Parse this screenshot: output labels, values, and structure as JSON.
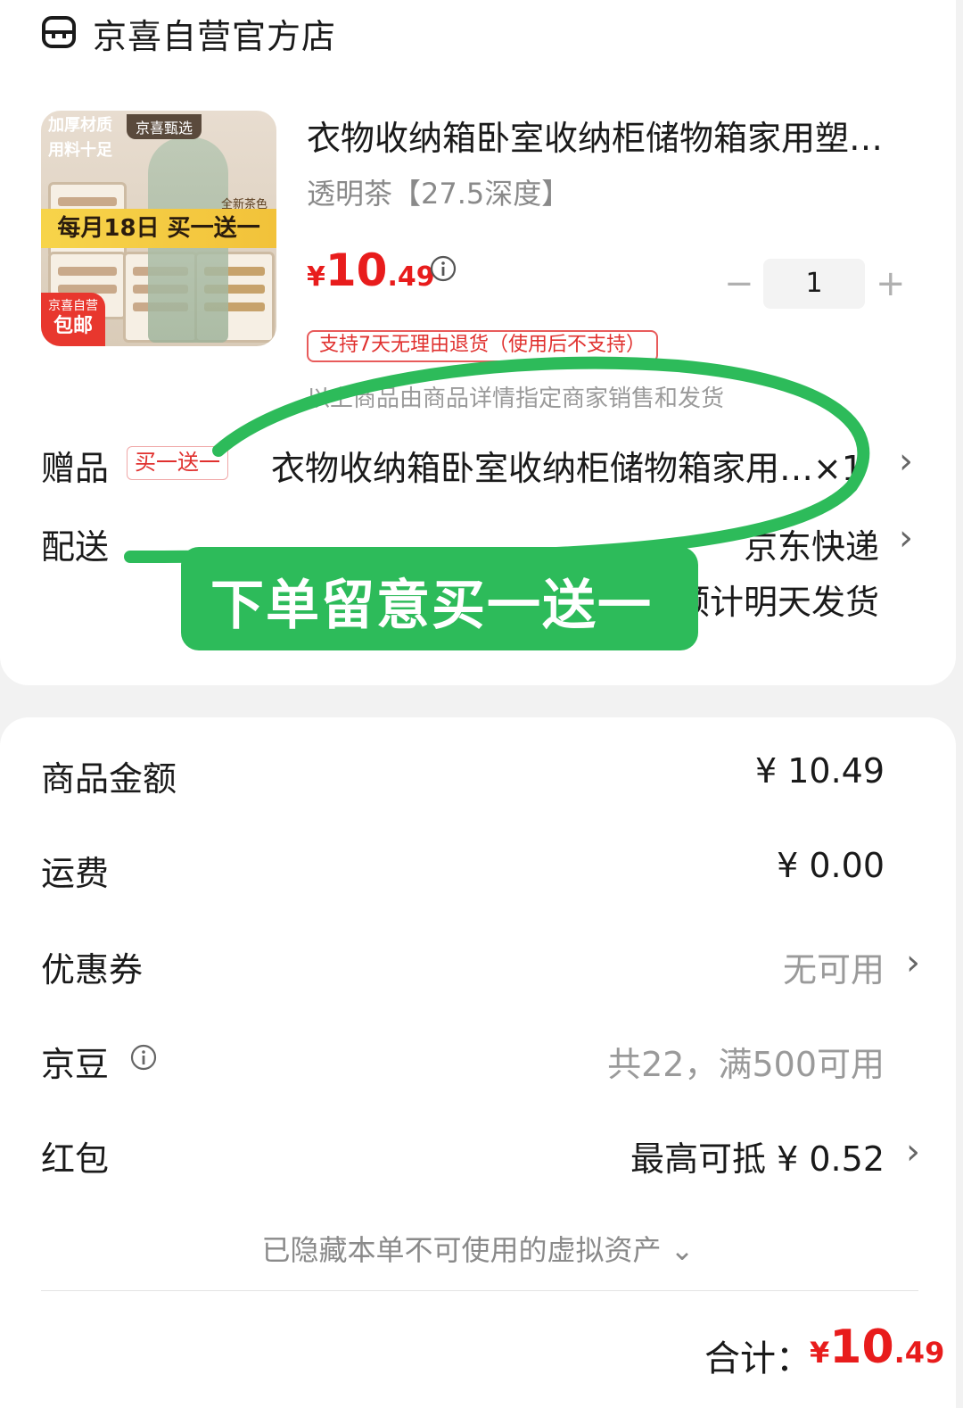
{
  "store": {
    "name": "京喜自营官方店",
    "icon": "store-icon"
  },
  "product": {
    "image": {
      "tag_line1": "加厚材质",
      "tag_line2": "用料十足",
      "brand_tag": "京喜甄选",
      "banner": "每月18日 买一送一",
      "color_tag": "全新茶色",
      "free_line1": "京喜自营",
      "free_line2": "包邮"
    },
    "title": "衣物收纳箱卧室收纳柜储物箱家用塑…",
    "spec": "透明茶【27.5深度】",
    "price": {
      "currency": "¥",
      "integer": "10",
      "decimal": ".49",
      "color": "#e81c1c"
    },
    "quantity": "1",
    "return_policy": "支持7天无理由退货（使用后不支持）",
    "seller_note": "以上商品由商品详情指定商家销售和发货"
  },
  "gift": {
    "label": "赠品",
    "tag": "买一送一",
    "text": "衣物收纳箱卧室收纳柜储物箱家用…×1"
  },
  "delivery": {
    "label": "配送",
    "method": "京东快递",
    "time": "预计明天发货"
  },
  "annotation": {
    "text": "下单留意买一送一",
    "color": "#2dbb5a"
  },
  "summary": {
    "goods_amount": {
      "label": "商品金额",
      "value": "¥ 10.49"
    },
    "shipping": {
      "label": "运费",
      "value": "¥ 0.00"
    },
    "coupon": {
      "label": "优惠券",
      "value": "无可用"
    },
    "jingdou": {
      "label": "京豆",
      "value": "共22，满500可用"
    },
    "redpacket": {
      "label": "红包",
      "value": "最高可抵 ¥ 0.52"
    },
    "hidden_note": "已隐藏本单不可使用的虚拟资产 ⌄",
    "total_label": "合计：",
    "total": {
      "currency": "¥",
      "integer": "10",
      "decimal": ".49"
    }
  }
}
